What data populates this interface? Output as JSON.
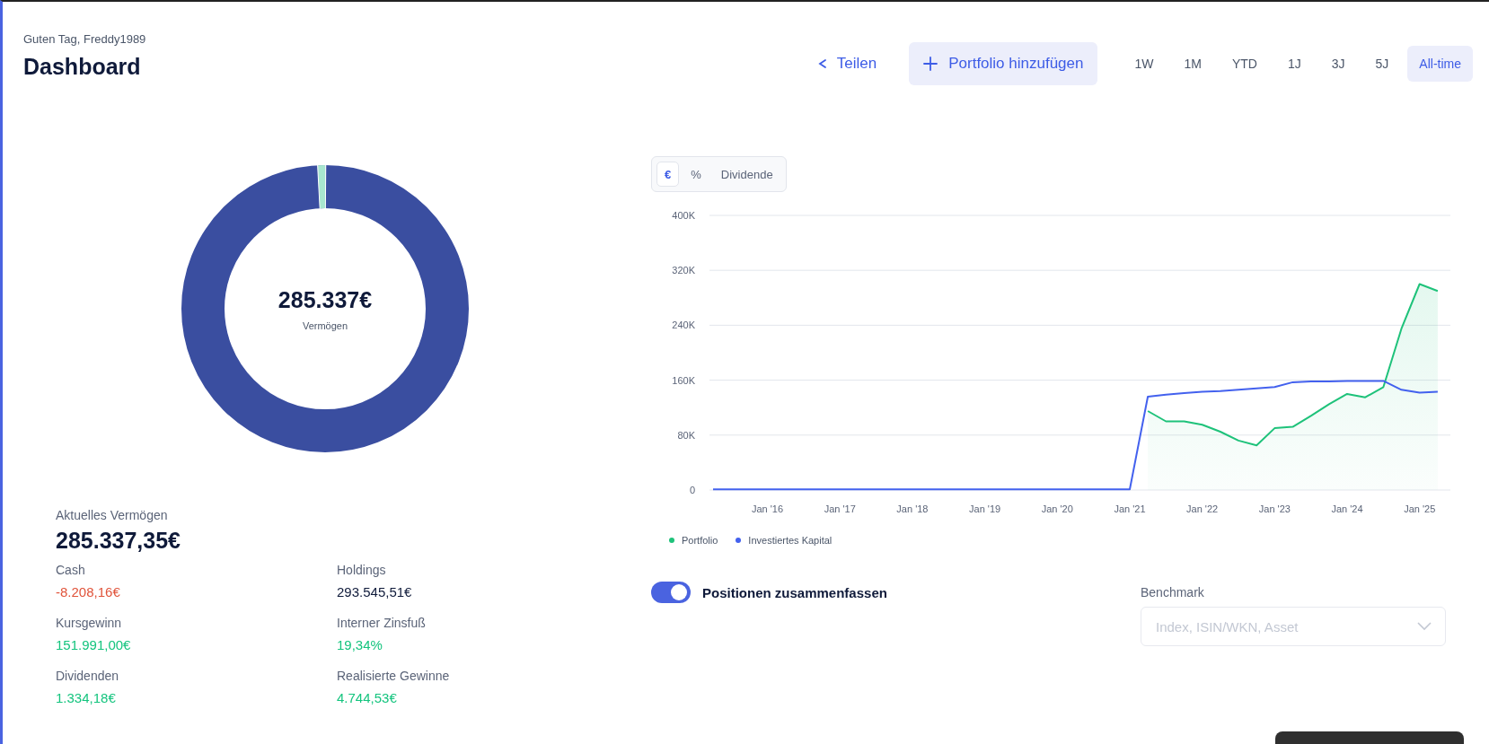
{
  "header": {
    "greeting": "Guten Tag, Freddy1989",
    "title": "Dashboard",
    "share_button": "Teilen",
    "add_button": "Portfolio hinzufügen"
  },
  "ranges": [
    {
      "label": "1W",
      "selected": false
    },
    {
      "label": "1M",
      "selected": false
    },
    {
      "label": "YTD",
      "selected": false
    },
    {
      "label": "1J",
      "selected": false
    },
    {
      "label": "3J",
      "selected": false
    },
    {
      "label": "5J",
      "selected": false
    },
    {
      "label": "All-time",
      "selected": true
    }
  ],
  "donut": {
    "value": "285.337€",
    "label": "Vermögen"
  },
  "summary": {
    "label": "Aktuelles Vermögen",
    "value": "285.337,35€"
  },
  "stats": [
    {
      "label": "Cash",
      "value": "-8.208,16€",
      "color": "#e0533a"
    },
    {
      "label": "Holdings",
      "value": "293.545,51€",
      "color": "#0f1a3a"
    },
    {
      "label": "Kursgewinn",
      "value": "151.991,00€",
      "color": "#14c47e"
    },
    {
      "label": "Interner Zinsfuß",
      "value": "19,34%",
      "color": "#14c47e"
    },
    {
      "label": "Dividenden",
      "value": "1.334,18€",
      "color": "#14c47e"
    },
    {
      "label": "Realisierte Gewinne",
      "value": "4.744,53€",
      "color": "#14c47e"
    }
  ],
  "chart_modes": [
    {
      "label": "€",
      "selected": true
    },
    {
      "label": "%",
      "selected": false
    },
    {
      "label": "Dividende",
      "selected": false
    }
  ],
  "chart_data": {
    "type": "line",
    "categories": [
      null,
      null,
      null,
      "Jan '16",
      null,
      null,
      null,
      "Jan '17",
      null,
      null,
      null,
      "Jan '18",
      null,
      null,
      null,
      "Jan '19",
      null,
      null,
      null,
      "Jan '20",
      null,
      null,
      null,
      "Jan '21",
      null,
      null,
      null,
      "Jan '22",
      null,
      null,
      null,
      "Jan '23",
      null,
      null,
      null,
      "Jan '24",
      null,
      null,
      null,
      "Jan '25",
      null
    ],
    "series": [
      {
        "name": "Portfolio",
        "color": "#1ec27a",
        "values": [
          null,
          null,
          null,
          null,
          null,
          null,
          null,
          null,
          null,
          null,
          null,
          null,
          null,
          null,
          null,
          null,
          null,
          null,
          null,
          null,
          null,
          null,
          null,
          null,
          115000,
          100000,
          100000,
          95000,
          85000,
          72000,
          65000,
          90000,
          92000,
          108000,
          125000,
          140000,
          135000,
          150000,
          235000,
          300000,
          290000
        ]
      },
      {
        "name": "Investiertes Kapital",
        "color": "#4361ee",
        "values": [
          1000,
          1000,
          1000,
          1000,
          1000,
          1000,
          1000,
          1000,
          1000,
          1000,
          1000,
          1000,
          1000,
          1000,
          1000,
          1000,
          1000,
          1000,
          1000,
          1000,
          1000,
          1000,
          1000,
          1000,
          136000,
          139000,
          141000,
          143000,
          144000,
          146000,
          148000,
          150000,
          157000,
          158000,
          158000,
          159000,
          159000,
          159000,
          146000,
          142000,
          143000
        ]
      }
    ],
    "ylim": [
      0,
      400000
    ],
    "grid": true,
    "yticks": [
      {
        "value": 0,
        "label": "0"
      },
      {
        "value": 80000,
        "label": "80K"
      },
      {
        "value": 160000,
        "label": "160K"
      },
      {
        "value": 240000,
        "label": "240K"
      },
      {
        "value": 320000,
        "label": "320K"
      },
      {
        "value": 400000,
        "label": "400K"
      }
    ]
  },
  "toggle": {
    "label": "Positionen zusammenfassen",
    "on": true
  },
  "benchmark": {
    "label": "Benchmark",
    "placeholder": "Index, ISIN/WKN, Asset"
  }
}
